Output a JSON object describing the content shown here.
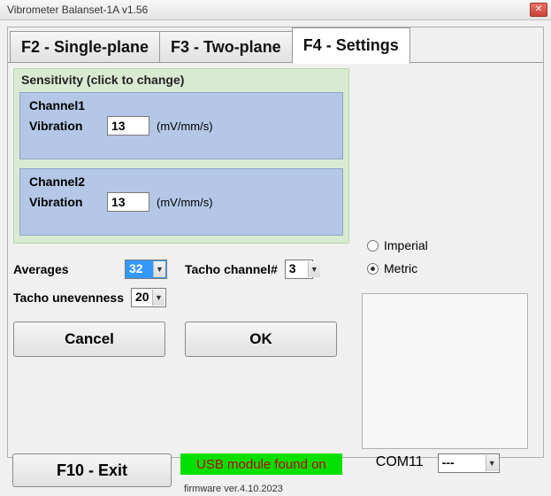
{
  "window": {
    "title": "Vibrometer Balanset-1A  v1.56"
  },
  "tabs": {
    "single_plane": "F2 - Single-plane",
    "two_plane": "F3 - Two-plane",
    "settings": "F4 - Settings"
  },
  "settings": {
    "sensitivity": {
      "title": "Sensitivity (click to change)",
      "channel1": {
        "name": "Channel1",
        "label": "Vibration",
        "value": "13",
        "unit": "(mV/mm/s)"
      },
      "channel2": {
        "name": "Channel2",
        "label": "Vibration",
        "value": "13",
        "unit": "(mV/mm/s)"
      }
    },
    "averages": {
      "label": "Averages",
      "value": "32"
    },
    "tacho_channel": {
      "label": "Tacho channel#",
      "value": "3"
    },
    "tacho_unevenness": {
      "label": "Tacho unevenness",
      "value": "20"
    },
    "units": {
      "imperial": "Imperial",
      "metric": "Metric",
      "selected": "metric"
    },
    "buttons": {
      "cancel": "Cancel",
      "ok": "OK"
    }
  },
  "footer": {
    "exit": "F10 - Exit",
    "usb_status": "USB module found on",
    "com_port": "COM11",
    "device_select": "---",
    "firmware": "firmware ver.4.10.2023"
  }
}
